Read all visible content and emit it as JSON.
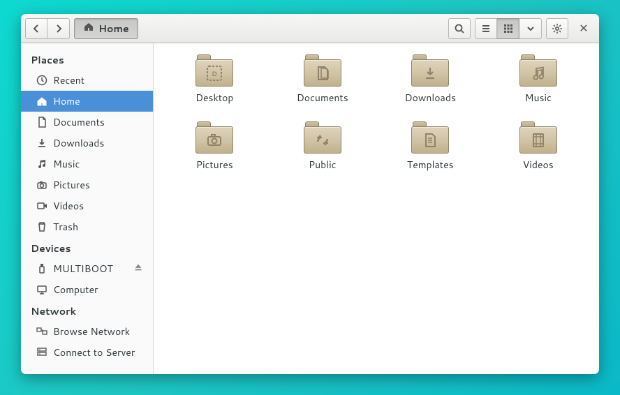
{
  "header": {
    "path_label": "Home"
  },
  "sidebar": {
    "sections": [
      {
        "title": "Places",
        "items": [
          {
            "id": "recent",
            "icon": "clock",
            "label": "Recent"
          },
          {
            "id": "home",
            "icon": "home",
            "label": "Home",
            "selected": true
          },
          {
            "id": "documents",
            "icon": "document",
            "label": "Documents"
          },
          {
            "id": "downloads",
            "icon": "download",
            "label": "Downloads"
          },
          {
            "id": "music",
            "icon": "music",
            "label": "Music"
          },
          {
            "id": "pictures",
            "icon": "camera",
            "label": "Pictures"
          },
          {
            "id": "videos",
            "icon": "video",
            "label": "Videos"
          },
          {
            "id": "trash",
            "icon": "trash",
            "label": "Trash"
          }
        ]
      },
      {
        "title": "Devices",
        "items": [
          {
            "id": "multiboot",
            "icon": "usb",
            "label": "MULTIBOOT",
            "ejectable": true
          },
          {
            "id": "computer",
            "icon": "computer",
            "label": "Computer"
          }
        ]
      },
      {
        "title": "Network",
        "items": [
          {
            "id": "browse-network",
            "icon": "network",
            "label": "Browse Network"
          },
          {
            "id": "connect-server",
            "icon": "server",
            "label": "Connect to Server"
          }
        ]
      }
    ]
  },
  "content": {
    "folders": [
      {
        "id": "desktop",
        "label": "Desktop",
        "glyph": "desktop"
      },
      {
        "id": "documents",
        "label": "Documents",
        "glyph": "documents"
      },
      {
        "id": "downloads",
        "label": "Downloads",
        "glyph": "download"
      },
      {
        "id": "music",
        "label": "Music",
        "glyph": "music"
      },
      {
        "id": "pictures",
        "label": "Pictures",
        "glyph": "camera"
      },
      {
        "id": "public",
        "label": "Public",
        "glyph": "public"
      },
      {
        "id": "templates",
        "label": "Templates",
        "glyph": "template"
      },
      {
        "id": "videos",
        "label": "Videos",
        "glyph": "film"
      }
    ]
  }
}
